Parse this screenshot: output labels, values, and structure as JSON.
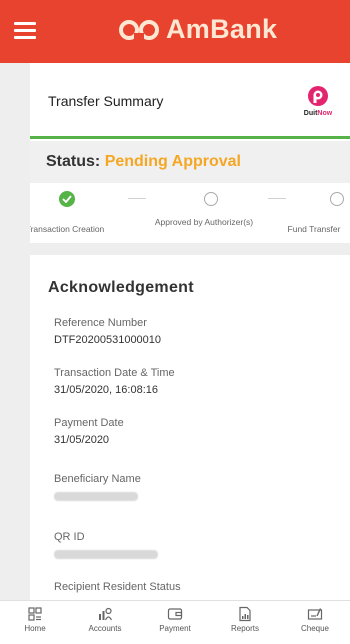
{
  "header": {
    "brand_name": "AmBank"
  },
  "summary": {
    "title": "Transfer Summary",
    "duitnow_prefix": "Duit",
    "duitnow_suffix": "Now"
  },
  "status": {
    "label": "Status:",
    "value": "Pending Approval"
  },
  "steps": [
    {
      "label": "Transaction Creation",
      "state": "done"
    },
    {
      "label": "Approved by Authorizer(s)",
      "state": "pending"
    },
    {
      "label": "Fund Transfer",
      "state": "pending"
    }
  ],
  "acknowledgement": {
    "title": "Acknowledgement",
    "fields": [
      {
        "label": "Reference Number",
        "value": "DTF20200531000010"
      },
      {
        "label": "Transaction Date & Time",
        "value": "31/05/2020, 16:08:16"
      },
      {
        "label": "Payment Date",
        "value": "31/05/2020"
      },
      {
        "label": "Beneficiary Name",
        "value": ""
      },
      {
        "label": "QR ID",
        "value": ""
      },
      {
        "label": "Recipient Resident Status",
        "value": ""
      }
    ]
  },
  "tabbar": {
    "items": [
      {
        "label": "Home",
        "icon": "home-icon"
      },
      {
        "label": "Accounts",
        "icon": "accounts-icon"
      },
      {
        "label": "Payment",
        "icon": "payment-icon"
      },
      {
        "label": "Reports",
        "icon": "reports-icon"
      },
      {
        "label": "Cheque",
        "icon": "cheque-icon"
      }
    ]
  },
  "colors": {
    "header_bg": "#e8432e",
    "status_pending": "#f5a623",
    "step_done": "#55b347",
    "duitnow_pink": "#e3256f"
  }
}
